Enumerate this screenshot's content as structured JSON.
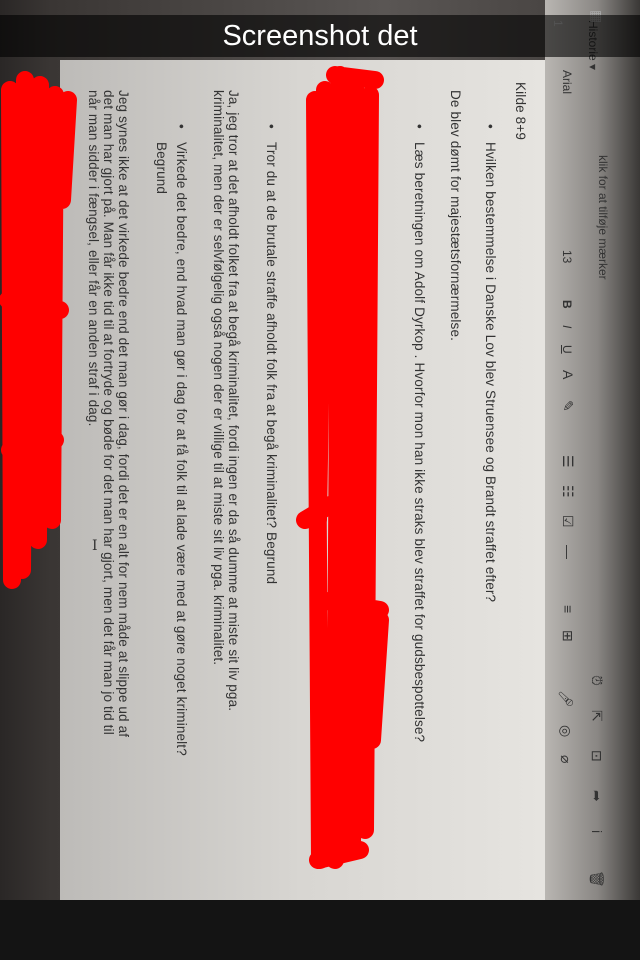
{
  "caption": "Screenshot det",
  "toolbar": {
    "history": "Historie ▾",
    "tags_placeholder": "klik for at tilføje mærker",
    "font": "Arial",
    "font_size": "13",
    "bold": "B",
    "italic": "I",
    "underline": "U",
    "top_left": "1"
  },
  "document": {
    "heading": "Kilde 8+9",
    "lines": [
      "Hvilken bestemmelse i Danske Lov blev Struensee og Brandt straffet efter?",
      "De blev dømt for majestætsfornærmelse.",
      "Læs beretningen om Adolf Dyrkop . Hvorfor mon han ikke straks blev straffet for gudsbespottelse?",
      "Tror du at de brutale straffe afholdt folk fra at begå kriminalitet? Begrund",
      "Ja, jeg tror at det afholdt folket fra at begå kriminalitet, fordi ingen er da så dumme at miste sit liv pga.",
      "kriminalitet, men der er selvfølgelig også nogen der er villige til at miste sit liv pga. kriminalitet.",
      "Virkede det bedre, end hvad man gør i dag for at få folk til at lade være med at gøre noget kriminelt?",
      "Begrund",
      "Jeg synes ikke at det virkede bedre end det man gør i dag, fordi det er en alt for nem måde at slippe ud af",
      "det man har gjort på. Man får ikke tid til at fortryde og bøde for det man har gjort, men det får man jo tid til",
      "når man sidder i fængsel, eller får en anden straf i dag."
    ]
  },
  "colors": {
    "scribble": "#ff0000"
  }
}
